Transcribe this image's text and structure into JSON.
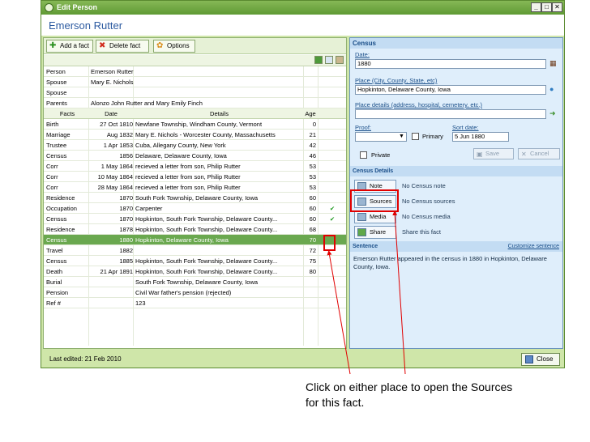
{
  "window": {
    "title": "Edit Person",
    "person_name": "Emerson Rutter"
  },
  "toolbar": {
    "add_fact": "Add a fact",
    "delete_fact": "Delete fact",
    "options": "Options"
  },
  "person": [
    {
      "label": "Person",
      "value": "Emerson Rutter"
    },
    {
      "label": "Spouse",
      "value": "Mary E. Nichols"
    },
    {
      "label": "Spouse",
      "value": ""
    },
    {
      "label": "Parents",
      "value": "Alonzo John Rutter and Mary Emily Finch"
    }
  ],
  "columns": {
    "facts": "Facts",
    "date": "Date",
    "details": "Details",
    "age": "Age"
  },
  "facts": [
    {
      "fact": "Birth",
      "date": "27 Oct 1810",
      "details": "Newfane Township, Windham County, Vermont",
      "age": "0",
      "source": ""
    },
    {
      "fact": "Marriage",
      "date": "Aug 1832",
      "details": "Mary E. Nichols - Worcester County, Massachusetts",
      "age": "21",
      "source": ""
    },
    {
      "fact": "Trustee",
      "date": "1 Apr 1853",
      "details": "Cuba, Allegany County, New York",
      "age": "42",
      "source": ""
    },
    {
      "fact": "Census",
      "date": "1856",
      "details": "Delaware, Delaware County, Iowa",
      "age": "46",
      "source": ""
    },
    {
      "fact": "Corr",
      "date": "1 May 1864",
      "details": "recieved a letter from son, Philip Rutter",
      "age": "53",
      "source": ""
    },
    {
      "fact": "Corr",
      "date": "10 May 1864",
      "details": "recieved a letter from son, Philip Rutter",
      "age": "53",
      "source": ""
    },
    {
      "fact": "Corr",
      "date": "28 May 1864",
      "details": "recieved a letter from son, Philip Rutter",
      "age": "53",
      "source": ""
    },
    {
      "fact": "Residence",
      "date": "1870",
      "details": "South Fork Township, Delaware County, Iowa",
      "age": "60",
      "source": ""
    },
    {
      "fact": "Occupation",
      "date": "1870",
      "details": "Carpenter",
      "age": "60",
      "source": "✔"
    },
    {
      "fact": "Census",
      "date": "1870",
      "details": "Hopkinton, South Fork Township, Delaware County...",
      "age": "60",
      "source": "✔"
    },
    {
      "fact": "Residence",
      "date": "1878",
      "details": "Hopkinton, South Fork Township, Delaware County...",
      "age": "68",
      "source": ""
    },
    {
      "fact": "Census",
      "date": "1880",
      "details": "Hopkinton, Delaware County, Iowa",
      "age": "70",
      "source": "",
      "selected": true
    },
    {
      "fact": "Travel",
      "date": "1882",
      "details": "",
      "age": "72",
      "source": ""
    },
    {
      "fact": "Census",
      "date": "1885",
      "details": "Hopkinton, South Fork Township, Delaware County...",
      "age": "75",
      "source": ""
    },
    {
      "fact": "Death",
      "date": "21 Apr 1891",
      "details": "Hopkinton, South Fork Township, Delaware County...",
      "age": "80",
      "source": ""
    },
    {
      "fact": "Burial",
      "date": "",
      "details": "South Fork Township, Delaware County, Iowa",
      "age": "",
      "source": ""
    },
    {
      "fact": "Pension",
      "date": "",
      "details": "Civil War father's pension (rejected)",
      "age": "",
      "source": ""
    },
    {
      "fact": "Ref #",
      "date": "",
      "details": "123",
      "age": "",
      "source": ""
    }
  ],
  "census_panel": {
    "title": "Census",
    "date_label": "Date:",
    "date_value": "1880",
    "place_label": "Place (City, County, State, etc)",
    "place_value": "Hopkinton, Delaware County, Iowa",
    "place_details_label": "Place details (address, hospital, cemetery, etc.)",
    "place_details_value": "",
    "proof_label": "Proof:",
    "primary_label": "Primary",
    "sort_date_label": "Sort date:",
    "sort_date_value": "5 Jun 1880",
    "private_label": "Private",
    "save_label": "Save",
    "cancel_label": "Cancel"
  },
  "census_details": {
    "title": "Census Details",
    "note_button": "Note",
    "note_text": "No Census note",
    "sources_button": "Sources",
    "sources_text": "No Census sources",
    "media_button": "Media",
    "media_text": "No Census media",
    "share_button": "Share",
    "share_text": "Share this fact"
  },
  "sentence": {
    "title": "Sentence",
    "customize_link": "Customize sentence",
    "text": "Emerson Rutter appeared in the census in 1880 in Hopkinton, Delaware County, Iowa."
  },
  "status": {
    "last_edited": "Last edited: 21 Feb 2010",
    "close_button": "Close"
  },
  "caption": "Click on either place to open the Sources for this fact.",
  "colors": {
    "selected_row": "#6aa84f",
    "highlight": "#e10000",
    "title_blue": "#2c5aa0"
  }
}
